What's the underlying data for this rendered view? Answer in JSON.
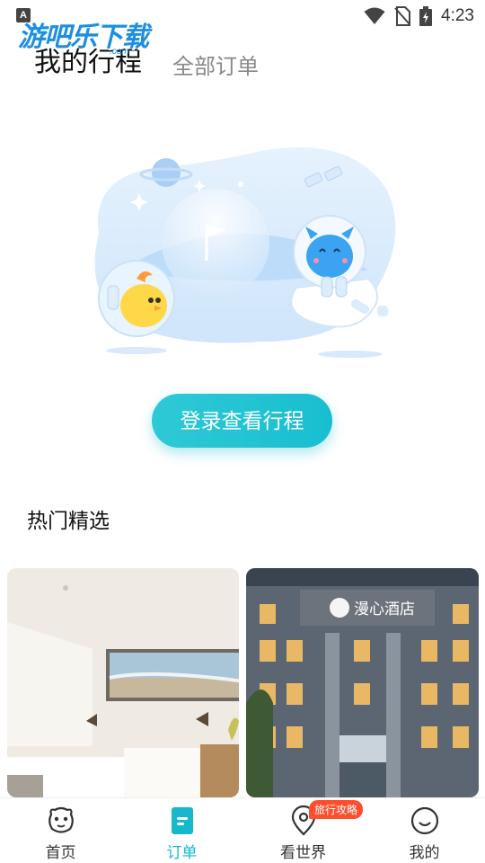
{
  "status_bar": {
    "indicator": "A",
    "time": "4:23",
    "icons": [
      "wifi-icon",
      "no-sim-icon",
      "battery-charging-icon"
    ]
  },
  "watermark": {
    "text": "游吧乐下载",
    "sub": ".com"
  },
  "header": {
    "tabs": [
      {
        "label": "我的行程",
        "active": true
      },
      {
        "label": "全部订单",
        "active": false
      }
    ]
  },
  "empty_state": {
    "login_button": "登录查看行程"
  },
  "hot_picks": {
    "title": "热门精选",
    "cards": [
      {
        "image": "hotel-room-photo"
      },
      {
        "image": "hotel-facade-photo",
        "sign_text": "漫心酒店"
      }
    ]
  },
  "bottom_nav": {
    "active_color": "#16b8cc",
    "items": [
      {
        "label": "首页",
        "icon": "home-mascot-icon",
        "active": false
      },
      {
        "label": "订单",
        "icon": "order-document-icon",
        "active": true
      },
      {
        "label": "看世界",
        "icon": "location-pin-icon",
        "active": false,
        "badge": "旅行攻略"
      },
      {
        "label": "我的",
        "icon": "smiley-face-icon",
        "active": false
      }
    ]
  }
}
